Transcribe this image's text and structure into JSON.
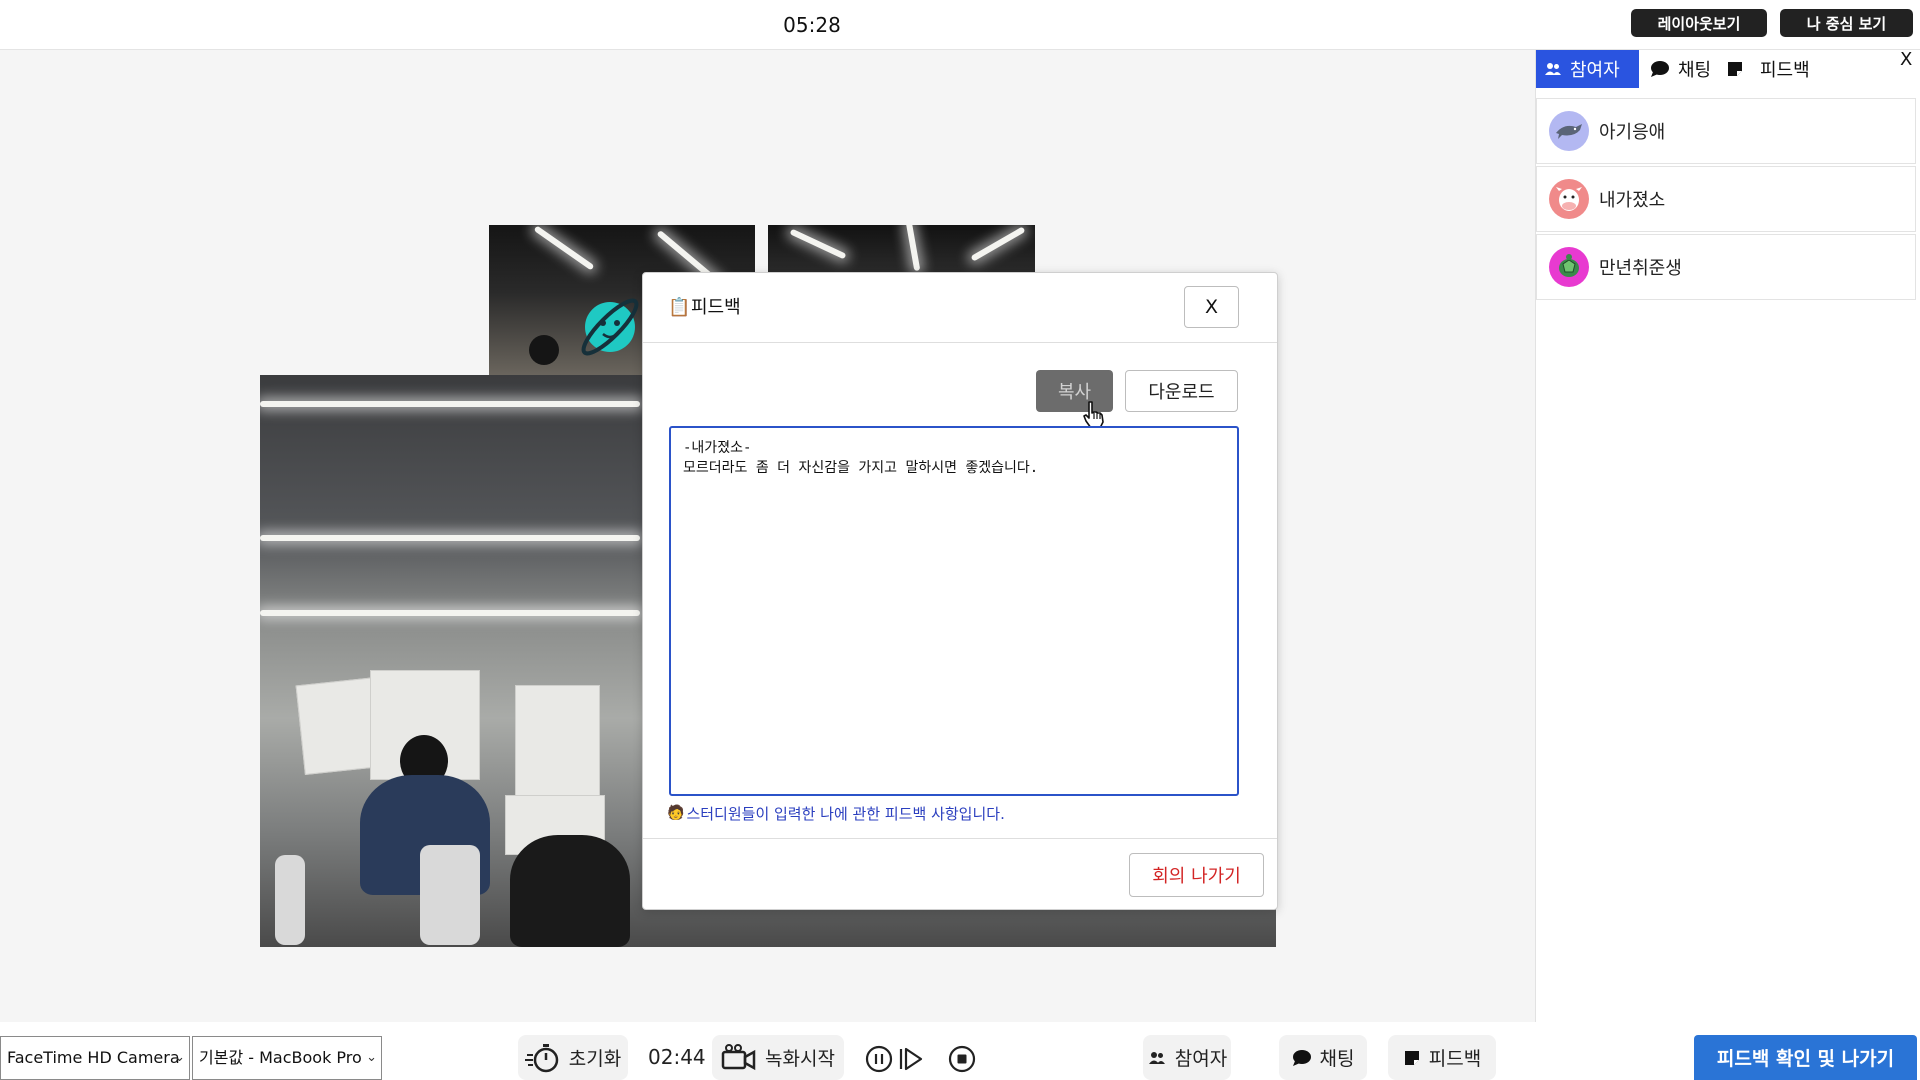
{
  "header": {
    "timer": "05:28",
    "layout_button": "레이아웃보기",
    "me_center_button": "나 중심 보기"
  },
  "modal": {
    "title_icon": "clipboard-icon",
    "title": "피드백",
    "close_label": "X",
    "copy_label": "복사",
    "download_label": "다운로드",
    "feedback_text": "-내가졌소-\n모르더라도 좀 더 자신감을 가지고 말하시면 좋겠습니다.",
    "hint_icon": "person-icon",
    "hint": "스터디원들이 입력한 나에 관한 피드백 사항입니다.",
    "leave_label": "회의 나가기"
  },
  "side_panel": {
    "tabs": [
      {
        "label": "참여자",
        "icon": "people-icon",
        "active": true
      },
      {
        "label": "채팅",
        "icon": "chat-bubble-icon",
        "active": false
      },
      {
        "label": "피드백",
        "icon": "note-icon",
        "active": false
      }
    ],
    "close_label": "X",
    "participants": [
      {
        "name": "아기응애",
        "avatar": "dolphin-avatar",
        "color": "#b3b8f2"
      },
      {
        "name": "내가졌소",
        "avatar": "cow-avatar",
        "color": "#f08a8a"
      },
      {
        "name": "만년취준생",
        "avatar": "turtle-avatar",
        "color": "#e83ad0"
      }
    ]
  },
  "bottom_bar": {
    "camera_select": "FaceTime HD Camera",
    "mic_select": "기본값 - MacBook Pro",
    "reset_label": "초기화",
    "elapsed": "02:44",
    "record_label": "녹화시작",
    "participants_label": "참여자",
    "chat_label": "채팅",
    "feedback_label": "피드백",
    "confirm_leave_label": "피드백 확인 및 나가기"
  },
  "colors": {
    "accent": "#2a54e0",
    "cta": "#2a74d6",
    "danger": "#d32525",
    "hint": "#2b3fbf"
  }
}
